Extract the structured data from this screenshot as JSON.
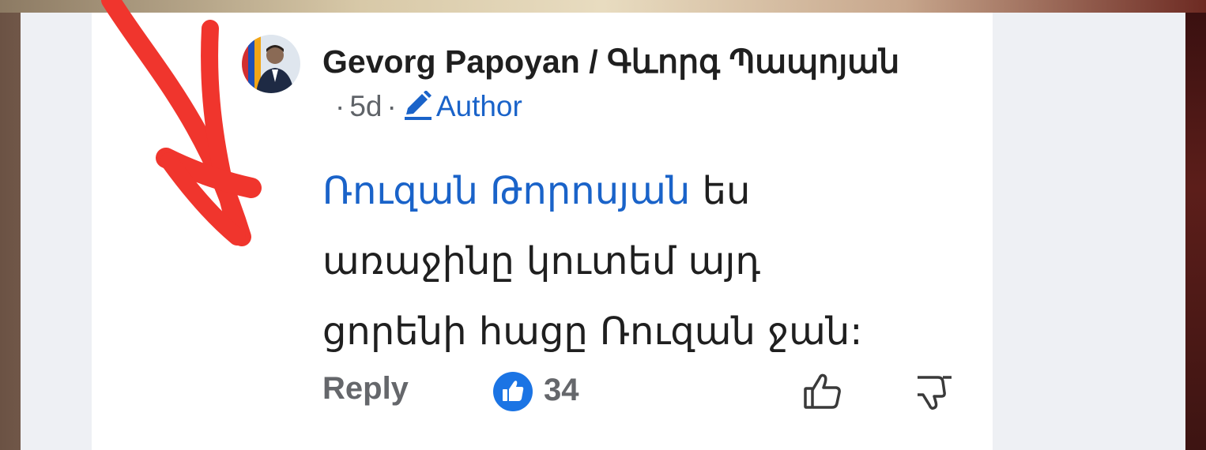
{
  "comment": {
    "author": "Gevorg Papoyan / Գևորգ Պապոյան",
    "time": "5d",
    "separator": "·",
    "author_badge": "Author",
    "mention": "Ռուզան Թորոսյան",
    "body_line1_rest": " ես",
    "body_line2": "առաջինը կուտեմ  այդ",
    "body_line3": "ցորենի հացը Ռուզան ջան:",
    "reply_label": "Reply",
    "like_count": "34"
  },
  "colors": {
    "mention": "#1a63c9",
    "like_badge": "#1b74e4",
    "annotation_arrow": "#f0352d"
  },
  "icons": {
    "author_badge": "pencil-icon",
    "like_badge": "like-badge-icon",
    "like_button": "thumbs-up-icon",
    "dislike_button": "thumbs-down-icon"
  }
}
